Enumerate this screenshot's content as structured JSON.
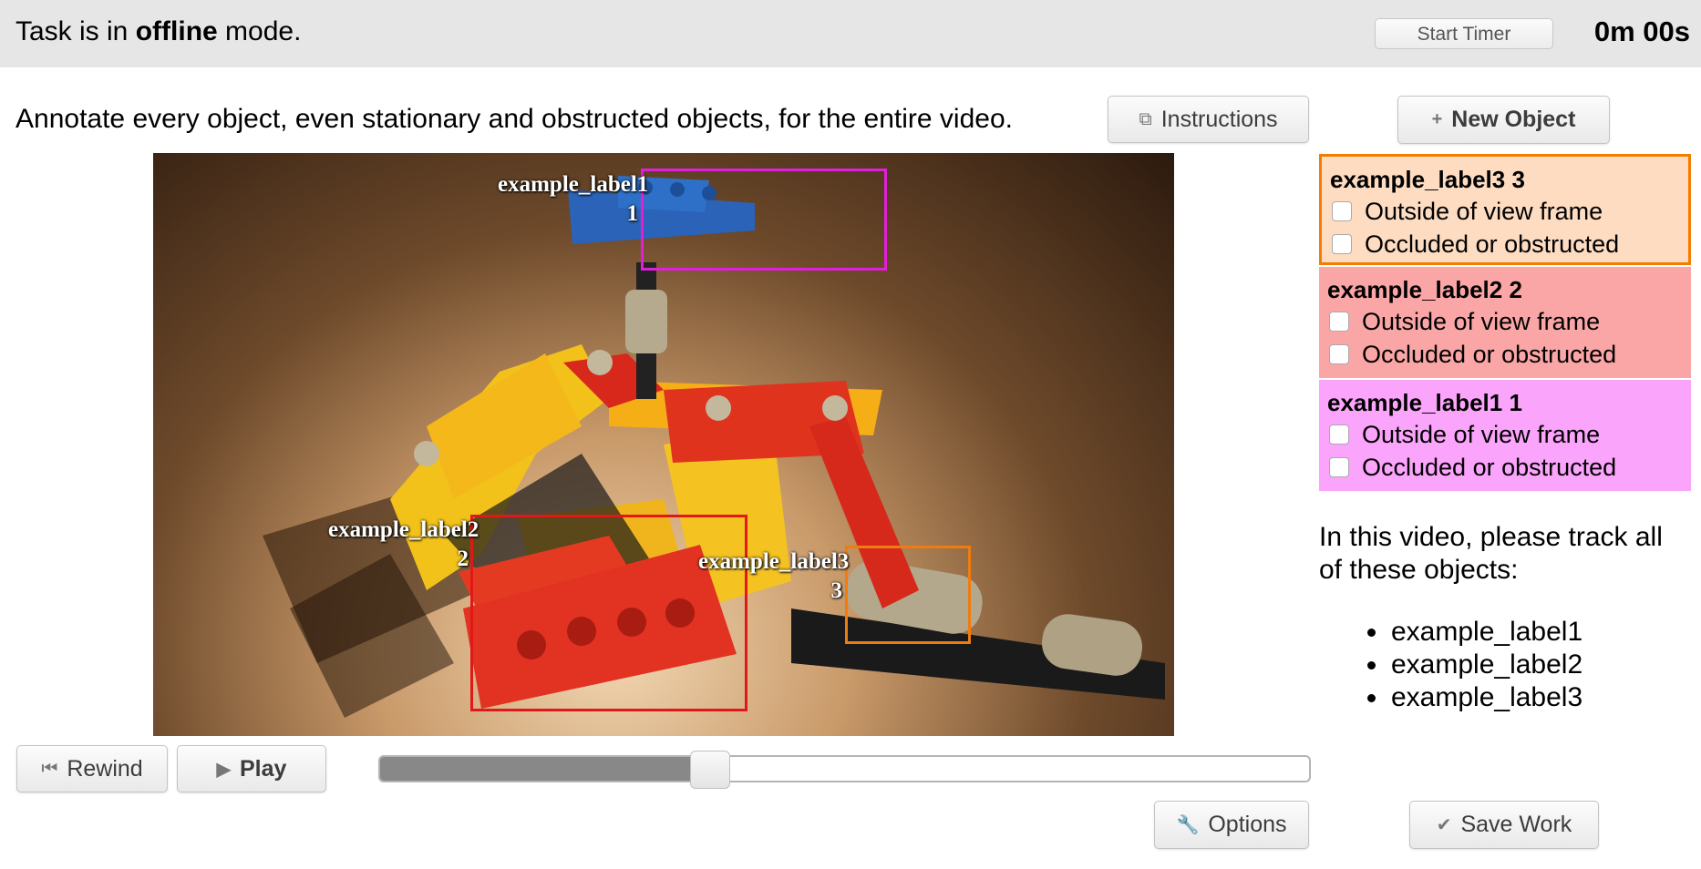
{
  "topbar": {
    "mode_prefix": "Task is in ",
    "mode_bold": "offline",
    "mode_suffix": " mode.",
    "start_timer_label": "Start Timer",
    "timer_value": "0m 00s"
  },
  "instructions_text": "Annotate every object, even stationary and obstructed objects, for the entire video.",
  "buttons": {
    "instructions": "Instructions",
    "new_object": "New Object",
    "rewind": "Rewind",
    "play": "Play",
    "options": "Options",
    "save_work": "Save Work"
  },
  "video": {
    "annotations": [
      {
        "label": "example_label1",
        "id": "1",
        "color": "#e020d8"
      },
      {
        "label": "example_label2",
        "id": "2",
        "color": "#e01818"
      },
      {
        "label": "example_label3",
        "id": "3",
        "color": "#f07c10"
      }
    ]
  },
  "playback": {
    "progress_fraction": 0.355
  },
  "objects": [
    {
      "title": "example_label3 3",
      "bg": "#fddcc2",
      "border": "#f47c00",
      "outside": "Outside of view frame",
      "occluded": "Occluded or obstructed"
    },
    {
      "title": "example_label2 2",
      "bg": "#fba6a6",
      "border": "",
      "outside": "Outside of view frame",
      "occluded": "Occluded or obstructed"
    },
    {
      "title": "example_label1 1",
      "bg": "#fba4fb",
      "border": "",
      "outside": "Outside of view frame",
      "occluded": "Occluded or obstructed"
    }
  ],
  "track_instructions": "In this video, please track all of these objects:",
  "track_list": [
    "example_label1",
    "example_label2",
    "example_label3"
  ]
}
